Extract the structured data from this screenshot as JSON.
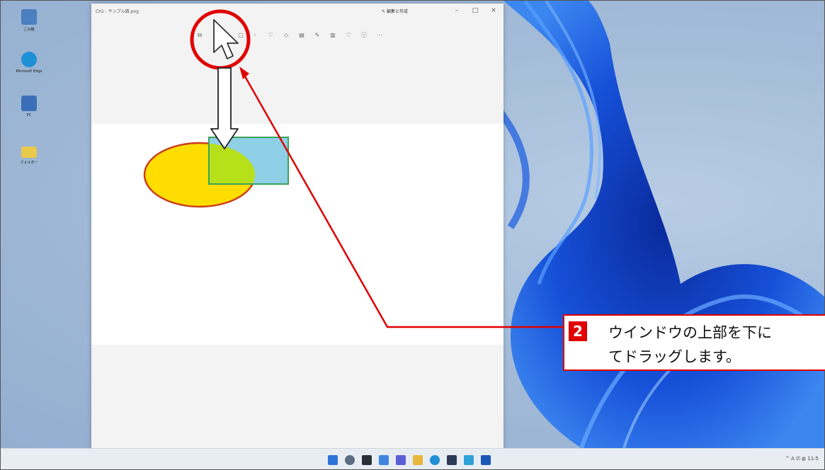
{
  "desktop": {
    "icons": [
      {
        "label": "ごみ箱",
        "color": "#4a7fc0"
      },
      {
        "label": "Microsoft Edge",
        "color": "#1f8fd6"
      },
      {
        "label": "PC",
        "color": "#3a6fb8"
      },
      {
        "label": "フォルダー",
        "color": "#e9c94a"
      }
    ]
  },
  "app": {
    "title": "Ch1 - サンプル図.png",
    "edit_label": "✎ 編集と作成",
    "controls": {
      "minimize": "–",
      "maximize": "□",
      "close": "×"
    }
  },
  "callout": {
    "step_number": "2",
    "line1": "ウインドウの上部を下に",
    "line2": "てドラッグします。"
  },
  "taskbar": {
    "apps": [
      "start",
      "search",
      "task-view",
      "widgets",
      "chat",
      "explorer",
      "edge",
      "store",
      "photos",
      "app"
    ],
    "tray_text": "^ A ⎚ ◍ 11:5"
  },
  "colors": {
    "accent_red": "#e00000",
    "ellipse_fill": "#ffdd00",
    "ellipse_stroke": "#c8401c",
    "rect_fill": "#8fd0e6",
    "rect_stroke": "#3aa35a",
    "overlap_fill": "#b5e01a"
  }
}
